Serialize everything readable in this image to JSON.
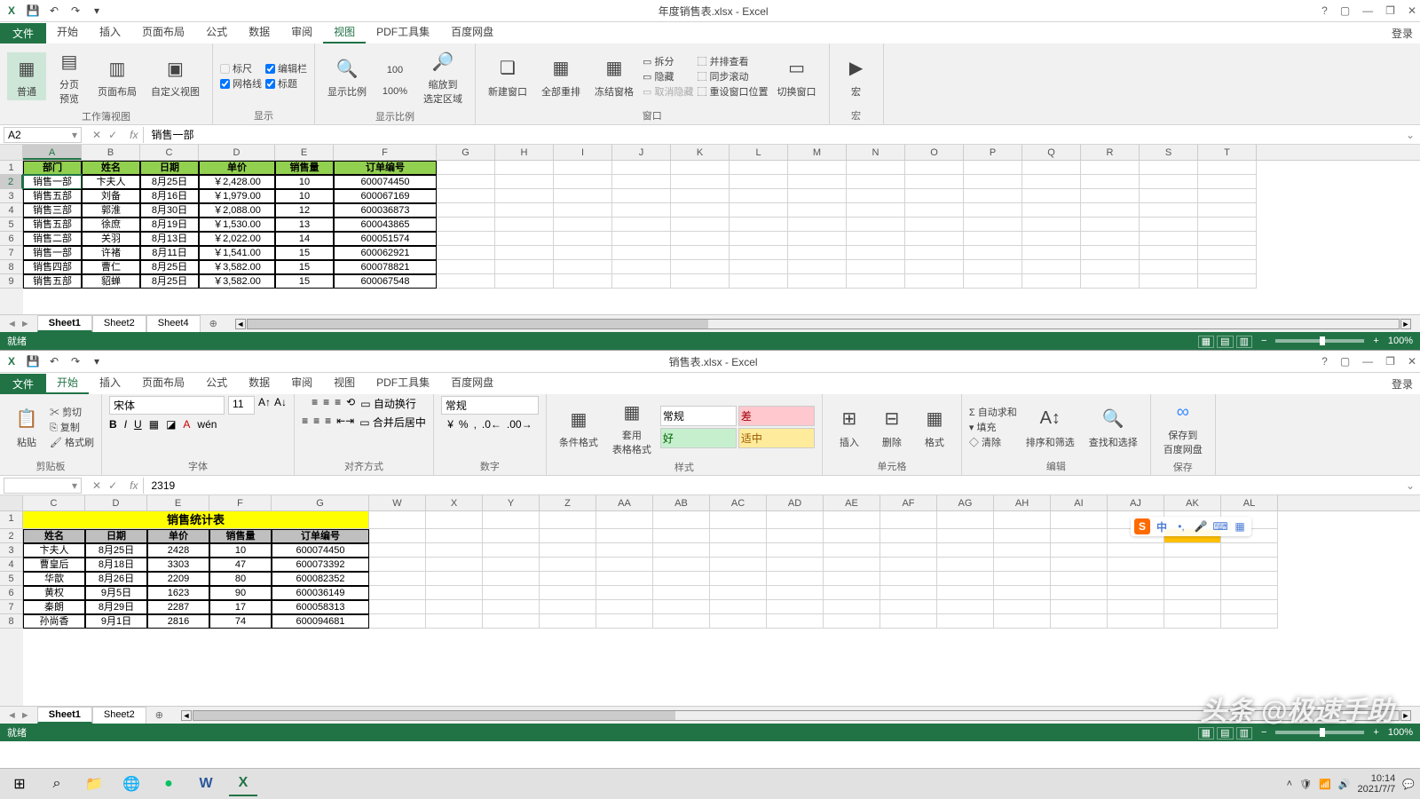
{
  "window1": {
    "title": "年度销售表.xlsx - Excel",
    "qat_icons": [
      "excel-icon",
      "save-icon",
      "undo-icon",
      "redo-icon",
      "customize-icon"
    ],
    "win_buttons": {
      "help": "?",
      "ribbon_opts": "▢",
      "minimize": "—",
      "restore": "❐",
      "close": "✕"
    },
    "login": "登录",
    "file_tab": "文件",
    "tabs": [
      "开始",
      "插入",
      "页面布局",
      "公式",
      "数据",
      "审阅",
      "视图",
      "PDF工具集",
      "百度网盘"
    ],
    "active_tab": "视图",
    "ribbon": {
      "group1": {
        "label": "工作簿视图",
        "buttons": [
          "普通",
          "分页\n预览",
          "页面布局",
          "自定义视图"
        ],
        "active": "普通"
      },
      "group2": {
        "label": "显示",
        "checks": [
          [
            "标尺",
            false
          ],
          [
            "编辑栏",
            true
          ],
          [
            "网格线",
            true
          ],
          [
            "标题",
            true
          ]
        ]
      },
      "group3": {
        "label": "显示比例",
        "buttons": [
          "显示比例",
          "100%",
          "缩放到\n选定区域"
        ]
      },
      "group4": {
        "label": "窗口",
        "buttons": [
          "新建窗口",
          "全部重排",
          "冻结窗格"
        ],
        "side": [
          "拆分",
          "隐藏",
          "取消隐藏"
        ],
        "side2": [
          "并排查看",
          "同步滚动",
          "重设窗口位置"
        ],
        "switch": "切换窗口"
      },
      "group5": {
        "label": "宏",
        "button": "宏"
      }
    },
    "namebox": "A2",
    "formula": "销售一部",
    "columns": [
      "A",
      "B",
      "C",
      "D",
      "E",
      "F",
      "G",
      "H",
      "I",
      "J",
      "K",
      "L",
      "M",
      "N",
      "O",
      "P",
      "Q",
      "R",
      "S",
      "T"
    ],
    "headers": [
      "部门",
      "姓名",
      "日期",
      "单价",
      "销售量",
      "订单编号"
    ],
    "rows": [
      [
        "销售一部",
        "卞夫人",
        "8月25日",
        "￥2,428.00",
        "10",
        "600074450"
      ],
      [
        "销售五部",
        "刘备",
        "8月16日",
        "￥1,979.00",
        "10",
        "600067169"
      ],
      [
        "销售三部",
        "郭淮",
        "8月30日",
        "￥2,088.00",
        "12",
        "600036873"
      ],
      [
        "销售五部",
        "徐庶",
        "8月19日",
        "￥1,530.00",
        "13",
        "600043865"
      ],
      [
        "销售二部",
        "关羽",
        "8月13日",
        "￥2,022.00",
        "14",
        "600051574"
      ],
      [
        "销售一部",
        "许褚",
        "8月11日",
        "￥1,541.00",
        "15",
        "600062921"
      ],
      [
        "销售四部",
        "曹仁",
        "8月25日",
        "￥3,582.00",
        "15",
        "600078821"
      ],
      [
        "销售五部",
        "貂蝉",
        "8月25日",
        "￥3,582.00",
        "15",
        "600067548"
      ]
    ],
    "sheets": [
      "Sheet1",
      "Sheet2",
      "Sheet4"
    ],
    "active_sheet": "Sheet1",
    "status": "就绪",
    "zoom": "100%"
  },
  "window2": {
    "title": "销售表.xlsx - Excel",
    "login": "登录",
    "file_tab": "文件",
    "tabs": [
      "开始",
      "插入",
      "页面布局",
      "公式",
      "数据",
      "审阅",
      "视图",
      "PDF工具集",
      "百度网盘"
    ],
    "active_tab": "开始",
    "ribbon": {
      "clipboard": {
        "label": "剪贴板",
        "paste": "粘贴",
        "cut": "剪切",
        "copy": "复制",
        "fmt": "格式刷"
      },
      "font": {
        "label": "字体",
        "name": "宋体",
        "size": "11"
      },
      "align": {
        "label": "对齐方式",
        "wrap": "自动换行",
        "merge": "合并后居中"
      },
      "number": {
        "label": "数字",
        "general": "常规"
      },
      "styles": {
        "label": "样式",
        "cond": "条件格式",
        "tbl": "套用\n表格格式",
        "normal": "常规",
        "bad": "差",
        "good": "好",
        "neutral": "适中"
      },
      "cells": {
        "label": "单元格",
        "insert": "插入",
        "delete": "删除",
        "format": "格式"
      },
      "editing": {
        "label": "编辑",
        "sum": "自动求和",
        "fill": "填充",
        "clear": "清除",
        "sort": "排序和筛选",
        "find": "查找和选择"
      },
      "save": {
        "label": "保存",
        "btn": "保存到\n百度网盘"
      }
    },
    "namebox": "",
    "formula": "2319",
    "columns": [
      "C",
      "D",
      "E",
      "F",
      "G",
      "W",
      "X",
      "Y",
      "Z",
      "AA",
      "AB",
      "AC",
      "AD",
      "AE",
      "AF",
      "AG",
      "AH",
      "AI",
      "AJ",
      "AK",
      "AL"
    ],
    "merged_title": "销售统计表",
    "headers": [
      "姓名",
      "日期",
      "单价",
      "销售量",
      "订单编号"
    ],
    "rows": [
      [
        "卞夫人",
        "8月25日",
        "2428",
        "10",
        "600074450"
      ],
      [
        "曹皇后",
        "8月18日",
        "3303",
        "47",
        "600073392"
      ],
      [
        "华歆",
        "8月26日",
        "2209",
        "80",
        "600082352"
      ],
      [
        "黄权",
        "9月5日",
        "1623",
        "90",
        "600036149"
      ],
      [
        "秦朗",
        "8月29日",
        "2287",
        "17",
        "600058313"
      ],
      [
        "孙尚香",
        "9月1日",
        "2816",
        "74",
        "600094681"
      ]
    ],
    "sheets": [
      "Sheet1",
      "Sheet2"
    ],
    "active_sheet": "Sheet1",
    "status": "就绪",
    "zoom": "100%"
  },
  "taskbar": {
    "time": "10:14",
    "date": "2021/7/7"
  },
  "watermark": "头条 @极速手助",
  "ime": {
    "logo": "S",
    "lang": "中"
  }
}
